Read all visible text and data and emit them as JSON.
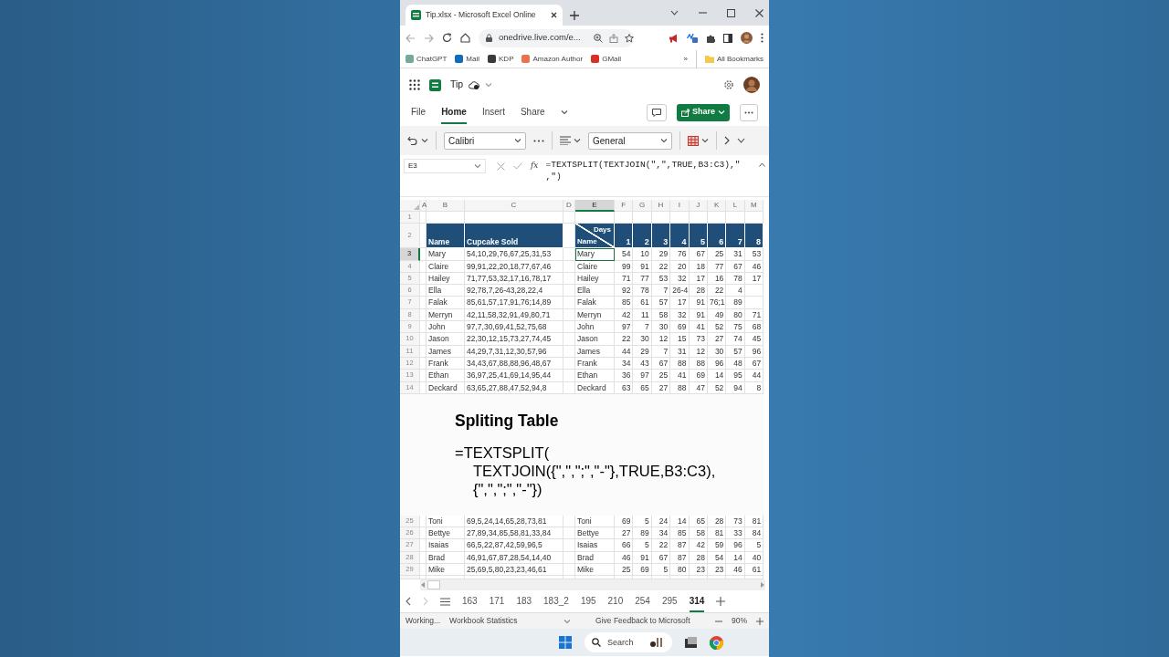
{
  "browser": {
    "tab_title": "Tip.xlsx - Microsoft Excel Online",
    "url": "onedrive.live.com/e...",
    "bookmarks": [
      {
        "label": "ChatGPT",
        "color": "#74aa9c"
      },
      {
        "label": "Mail",
        "color": "#0f6cbd"
      },
      {
        "label": "KDP",
        "color": "#3a3a3a"
      },
      {
        "label": "Amazon Author",
        "color": "#e8744f"
      },
      {
        "label": "GMail",
        "color": "#d93025"
      }
    ],
    "overflow": "»",
    "all_bookmarks": "All Bookmarks"
  },
  "app": {
    "file_name": "Tip"
  },
  "ribbon_tabs": [
    {
      "label": "File",
      "selected": false
    },
    {
      "label": "Home",
      "selected": true
    },
    {
      "label": "Insert",
      "selected": false
    },
    {
      "label": "Share",
      "selected": false
    }
  ],
  "share_button": "Share",
  "toolbar": {
    "font": "Calibri",
    "number_format": "General"
  },
  "formula_bar": {
    "name_box": "E3",
    "function_label": "fx",
    "formula_lines": [
      "=TEXTSPLIT(TEXTJOIN(\",\",TRUE,B3:C3),\"",
      ",\")"
    ]
  },
  "columns": [
    {
      "label": "A",
      "selected": false
    },
    {
      "label": "B",
      "selected": false
    },
    {
      "label": "C",
      "selected": false
    },
    {
      "label": "D",
      "selected": false
    },
    {
      "label": "E",
      "selected": true
    },
    {
      "label": "F",
      "selected": false
    },
    {
      "label": "G",
      "selected": false
    },
    {
      "label": "H",
      "selected": false
    },
    {
      "label": "I",
      "selected": false
    },
    {
      "label": "J",
      "selected": false
    },
    {
      "label": "K",
      "selected": false
    },
    {
      "label": "L",
      "selected": false
    },
    {
      "label": "M",
      "selected": false
    }
  ],
  "header": {
    "top_rows": [
      "1",
      "2"
    ],
    "name": "Name",
    "sold": "Cupcake Sold",
    "days": "Days",
    "split_name": "Name",
    "day_numbers": [
      "1",
      "2",
      "3",
      "4",
      "5",
      "6",
      "7",
      "8"
    ]
  },
  "rows": [
    {
      "label": "3",
      "selected": true,
      "name": "Mary",
      "sold": "54,10,29,76,67,25,31,53",
      "split": [
        "Mary",
        "54",
        "10",
        "29",
        "76",
        "67",
        "25",
        "31",
        "53"
      ]
    },
    {
      "label": "4",
      "selected": false,
      "name": "Claire",
      "sold": "99,91,22,20,18,77,67,46",
      "split": [
        "Claire",
        "99",
        "91",
        "22",
        "20",
        "18",
        "77",
        "67",
        "46"
      ]
    },
    {
      "label": "5",
      "selected": false,
      "name": "Hailey",
      "sold": "71,77,53,32,17,16,78,17",
      "split": [
        "Hailey",
        "71",
        "77",
        "53",
        "32",
        "17",
        "16",
        "78",
        "17"
      ]
    },
    {
      "label": "6",
      "selected": false,
      "name": "Ella",
      "sold": "92,78,7,26-43,28,22,4",
      "split": [
        "Ella",
        "92",
        "78",
        "7",
        "26-4",
        "28",
        "22",
        "4"
      ]
    },
    {
      "label": "7",
      "selected": false,
      "name": "Falak",
      "sold": "85,61,57,17,91,76;14,89",
      "split": [
        "Falak",
        "85",
        "61",
        "57",
        "17",
        "91",
        "76;1",
        "89"
      ]
    },
    {
      "label": "8",
      "selected": false,
      "name": "Merryn",
      "sold": "42,11,58,32,91,49,80,71",
      "split": [
        "Merryn",
        "42",
        "11",
        "58",
        "32",
        "91",
        "49",
        "80",
        "71"
      ]
    },
    {
      "label": "9",
      "selected": false,
      "name": "John",
      "sold": "97,7,30,69,41,52,75,68",
      "split": [
        "John",
        "97",
        "7",
        "30",
        "69",
        "41",
        "52",
        "75",
        "68"
      ]
    },
    {
      "label": "10",
      "selected": false,
      "name": "Jason",
      "sold": "22,30,12,15,73,27,74,45",
      "split": [
        "Jason",
        "22",
        "30",
        "12",
        "15",
        "73",
        "27",
        "74",
        "45"
      ]
    },
    {
      "label": "11",
      "selected": false,
      "name": "James",
      "sold": "44,29,7,31,12,30,57,96",
      "split": [
        "James",
        "44",
        "29",
        "7",
        "31",
        "12",
        "30",
        "57",
        "96"
      ]
    },
    {
      "label": "12",
      "selected": false,
      "name": "Frank",
      "sold": "34,43,67,88,88,96,48,67",
      "split": [
        "Frank",
        "34",
        "43",
        "67",
        "88",
        "88",
        "96",
        "48",
        "67"
      ]
    },
    {
      "label": "13",
      "selected": false,
      "name": "Ethan",
      "sold": "36,97,25,41,69,14,95,44",
      "split": [
        "Ethan",
        "36",
        "97",
        "25",
        "41",
        "69",
        "14",
        "95",
        "44"
      ]
    },
    {
      "label": "14",
      "selected": false,
      "name": "Deckard",
      "sold": "63,65,27,88,47,52,94,8",
      "split": [
        "Deckard",
        "63",
        "65",
        "27",
        "88",
        "47",
        "52",
        "94",
        "8"
      ]
    }
  ],
  "overlay": {
    "title": "Spliting Table",
    "formula_lines": [
      "=TEXTSPLIT(",
      "TEXTJOIN({\",\",\";\",\"-\"},TRUE,B3:C3),",
      "{\",\",\";\",\"-\"})"
    ]
  },
  "rows_after": [
    {
      "label": "25",
      "selected": false,
      "name": "Toni",
      "sold": "69,5,24,14,65,28,73,81",
      "split": [
        "Toni",
        "69",
        "5",
        "24",
        "14",
        "65",
        "28",
        "73",
        "81"
      ]
    },
    {
      "label": "26",
      "selected": false,
      "name": "Bettye",
      "sold": "27,89,34,85,58,81,33,84",
      "split": [
        "Bettye",
        "27",
        "89",
        "34",
        "85",
        "58",
        "81",
        "33",
        "84"
      ]
    },
    {
      "label": "27",
      "selected": false,
      "name": "Isaias",
      "sold": "66,5,22,87,42,59,96,5",
      "split": [
        "Isaias",
        "66",
        "5",
        "22",
        "87",
        "42",
        "59",
        "96",
        "5"
      ]
    },
    {
      "label": "28",
      "selected": false,
      "name": "Brad",
      "sold": "46,91,67,87,28,54,14,40",
      "split": [
        "Brad",
        "46",
        "91",
        "67",
        "87",
        "28",
        "54",
        "14",
        "40"
      ]
    },
    {
      "label": "29",
      "selected": false,
      "name": "Mike",
      "sold": "25,69,5,80,23,23,46,61",
      "split": [
        "Mike",
        "25",
        "69",
        "5",
        "80",
        "23",
        "23",
        "46",
        "61"
      ]
    }
  ],
  "sheet_tabs": [
    {
      "label": "163",
      "selected": false
    },
    {
      "label": "171",
      "selected": false
    },
    {
      "label": "183",
      "selected": false
    },
    {
      "label": "183_2",
      "selected": false
    },
    {
      "label": "195",
      "selected": false
    },
    {
      "label": "210",
      "selected": false
    },
    {
      "label": "254",
      "selected": false
    },
    {
      "label": "295",
      "selected": false
    },
    {
      "label": "314",
      "selected": true
    }
  ],
  "status_bar": {
    "state": "Working...",
    "stats": "Workbook Statistics",
    "feedback": "Give Feedback to Microsoft",
    "zoom": "90%"
  },
  "taskbar": {
    "search": "Search"
  }
}
